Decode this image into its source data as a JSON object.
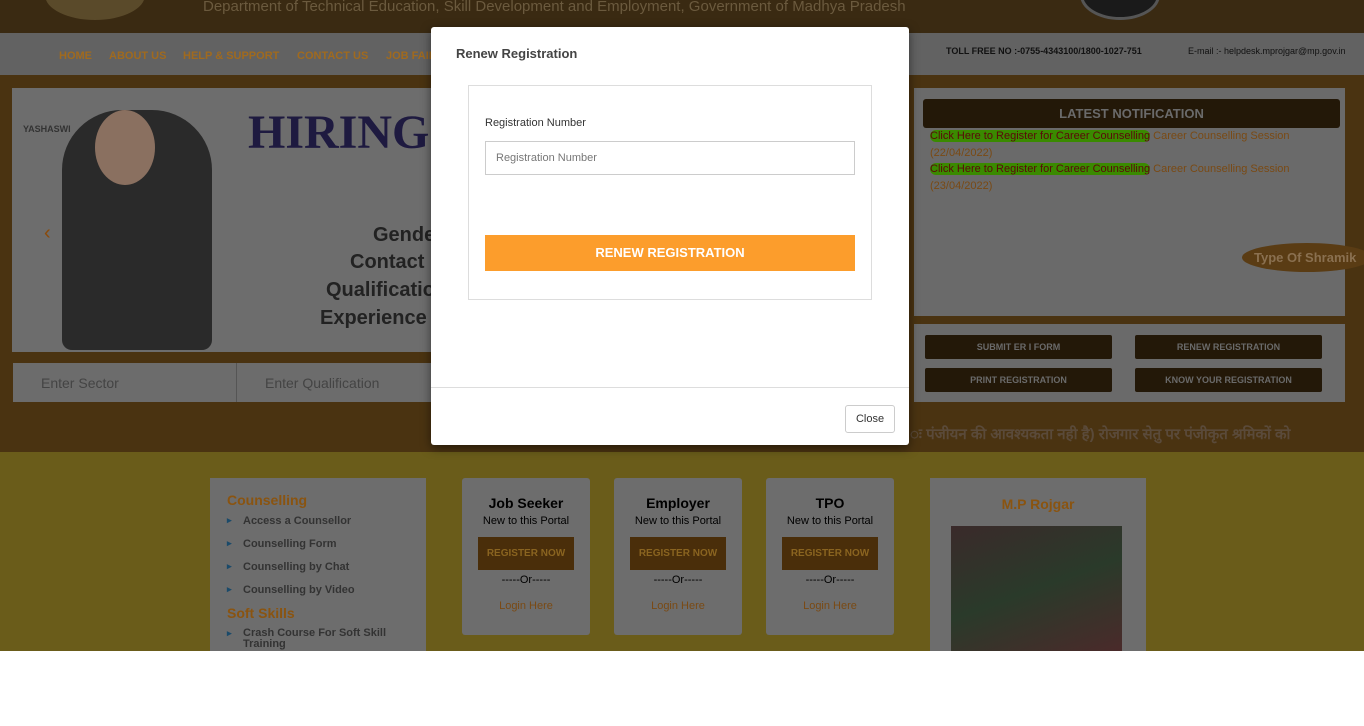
{
  "header": {
    "department": "Department of Technical Education, Skill Development and Employment, Government of Madhya Pradesh",
    "toll_free": "TOLL FREE NO :-0755-4343100/1800-1027-751",
    "email": "E-mail :- helpdesk.mprojgar@mp.gov.in"
  },
  "nav": [
    "HOME",
    "ABOUT US",
    "HELP & SUPPORT",
    "CONTACT US",
    "JOB FAIR"
  ],
  "banner": {
    "brand": "YASHASWI",
    "heading": "HIRING",
    "lines": [
      "Gender",
      "Contact",
      "Qualification",
      "Experience"
    ]
  },
  "search": {
    "sector_placeholder": "Enter Sector",
    "qualification_placeholder": "Enter Qualification"
  },
  "notifications": {
    "title": "LATEST NOTIFICATION",
    "items": [
      {
        "link": "Click Here to Register for Career Counselling",
        "text": "Career Counselling Session (22/04/2022)"
      },
      {
        "link": "Click Here to Register for Career Counselling",
        "text": "Career Counselling Session (23/04/2022)"
      }
    ],
    "badge": "Type Of Shramik"
  },
  "actions": [
    "SUBMIT ER I FORM",
    "RENEW REGISTRATION",
    "PRINT REGISTRATION",
    "KNOW YOUR REGISTRATION"
  ],
  "marquee": "ः पंजीयन की आवश्यकता नही है)  रोजगार सेतु पर पंजीकृत श्रमिकों को",
  "counselling": {
    "title": "Counselling",
    "items": [
      "Access a Counsellor",
      "Counselling Form",
      "Counselling by Chat",
      "Counselling by Video"
    ],
    "soft_title": "Soft Skills",
    "soft_items": [
      "Crash Course For Soft Skill Training"
    ]
  },
  "cards": [
    {
      "title": "Job Seeker",
      "sub": "New to this Portal",
      "register": "REGISTER NOW",
      "or": "-----Or-----",
      "login": "Login Here"
    },
    {
      "title": "Employer",
      "sub": "New to this Portal",
      "register": "REGISTER NOW",
      "or": "-----Or-----",
      "login": "Login Here"
    },
    {
      "title": "TPO",
      "sub": "New to this Portal",
      "register": "REGISTER NOW",
      "or": "-----Or-----",
      "login": "Login Here"
    }
  ],
  "mp": {
    "title": "M.P Rojgar"
  },
  "modal": {
    "title": "Renew Registration",
    "label": "Registration Number",
    "placeholder": "Registration Number",
    "submit": "RENEW REGISTRATION",
    "close": "Close",
    "accent": "#fc9d2c"
  }
}
